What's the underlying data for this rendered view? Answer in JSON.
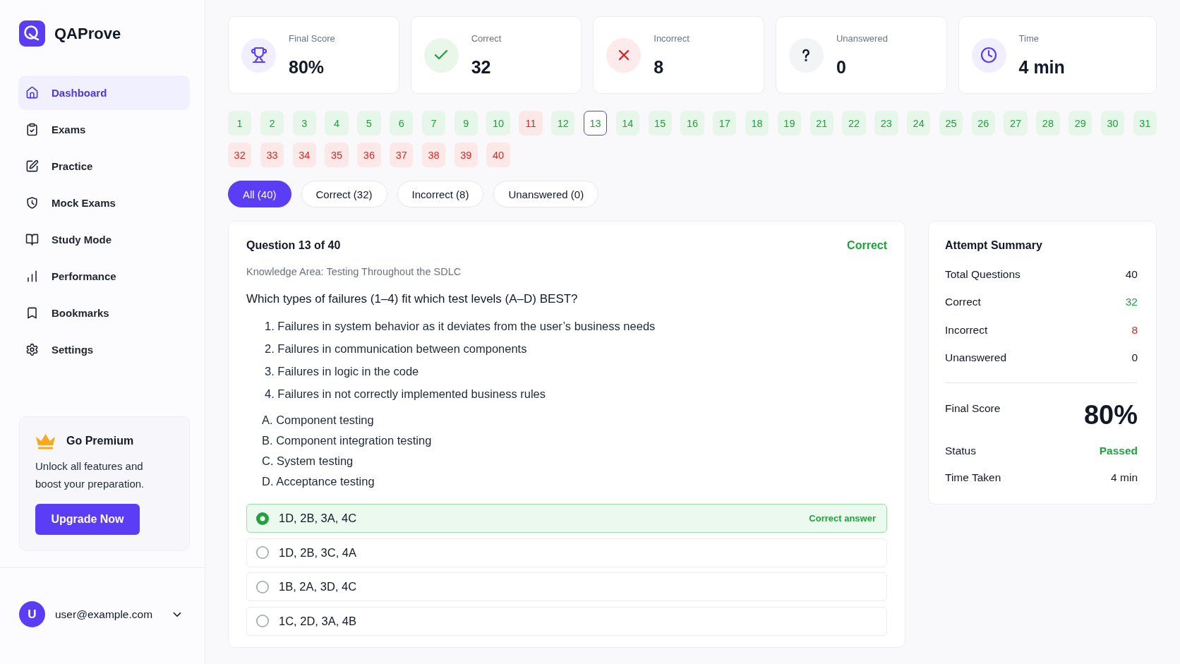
{
  "sidebar": {
    "brand": "QAProve",
    "nav": [
      {
        "label": "Dashboard",
        "selected": true
      },
      {
        "label": "Exams",
        "selected": false
      },
      {
        "label": "Practice",
        "selected": false
      },
      {
        "label": "Mock Exams",
        "selected": false
      },
      {
        "label": "Study Mode",
        "selected": false
      },
      {
        "label": "Performance",
        "selected": false
      },
      {
        "label": "Bookmarks",
        "selected": false
      },
      {
        "label": "Settings",
        "selected": false
      }
    ],
    "promo": {
      "title": "Go Premium",
      "text": "Unlock all features and boost your preparation.",
      "button": "Upgrade Now"
    },
    "user": {
      "initial": "U",
      "email": "user@example.com"
    }
  },
  "stats": [
    {
      "kind": "score",
      "label": "Final Score",
      "value": "80%"
    },
    {
      "kind": "correct",
      "label": "Correct",
      "value": "32"
    },
    {
      "kind": "incorrect",
      "label": "Incorrect",
      "value": "8"
    },
    {
      "kind": "unanswered",
      "label": "Unanswered",
      "value": "0"
    },
    {
      "kind": "time",
      "label": "Time",
      "value": "4 min"
    }
  ],
  "question_nav": [
    {
      "number": "1",
      "correct": true,
      "selected": false
    },
    {
      "number": "2",
      "correct": true,
      "selected": false
    },
    {
      "number": "3",
      "correct": true,
      "selected": false
    },
    {
      "number": "4",
      "correct": true,
      "selected": false
    },
    {
      "number": "5",
      "correct": true,
      "selected": false
    },
    {
      "number": "6",
      "correct": true,
      "selected": false
    },
    {
      "number": "7",
      "correct": true,
      "selected": false
    },
    {
      "number": "9",
      "correct": true,
      "selected": false
    },
    {
      "number": "10",
      "correct": true,
      "selected": false
    },
    {
      "number": "11",
      "correct": false,
      "selected": false
    },
    {
      "number": "12",
      "correct": true,
      "selected": false
    },
    {
      "number": "13",
      "correct": true,
      "selected": true
    },
    {
      "number": "14",
      "correct": true,
      "selected": false
    },
    {
      "number": "15",
      "correct": true,
      "selected": false
    },
    {
      "number": "16",
      "correct": true,
      "selected": false
    },
    {
      "number": "17",
      "correct": true,
      "selected": false
    },
    {
      "number": "18",
      "correct": true,
      "selected": false
    },
    {
      "number": "19",
      "correct": true,
      "selected": false
    },
    {
      "number": "21",
      "correct": true,
      "selected": false
    },
    {
      "number": "22",
      "correct": true,
      "selected": false
    },
    {
      "number": "23",
      "correct": true,
      "selected": false
    },
    {
      "number": "24",
      "correct": true,
      "selected": false
    },
    {
      "number": "25",
      "correct": true,
      "selected": false
    },
    {
      "number": "26",
      "correct": true,
      "selected": false
    },
    {
      "number": "27",
      "correct": true,
      "selected": false
    },
    {
      "number": "28",
      "correct": true,
      "selected": false
    },
    {
      "number": "29",
      "correct": true,
      "selected": false
    },
    {
      "number": "30",
      "correct": true,
      "selected": false
    },
    {
      "number": "31",
      "correct": true,
      "selected": false
    },
    {
      "number": "32",
      "correct": false,
      "selected": false
    },
    {
      "number": "33",
      "correct": false,
      "selected": false
    },
    {
      "number": "34",
      "correct": false,
      "selected": false
    },
    {
      "number": "35",
      "correct": false,
      "selected": false
    },
    {
      "number": "36",
      "correct": false,
      "selected": false
    },
    {
      "number": "37",
      "correct": false,
      "selected": false
    },
    {
      "number": "38",
      "correct": false,
      "selected": false
    },
    {
      "number": "39",
      "correct": false,
      "selected": false
    },
    {
      "number": "40",
      "correct": false,
      "selected": false
    }
  ],
  "filters": [
    {
      "label": "All (40)",
      "selected": true
    },
    {
      "label": "Correct (32)",
      "selected": false
    },
    {
      "label": "Incorrect (8)",
      "selected": false
    },
    {
      "label": "Unanswered (0)",
      "selected": false
    }
  ],
  "question": {
    "title": "Question 13 of 40",
    "result": {
      "label": "Correct",
      "correct": true
    },
    "area": "Knowledge Area: Testing Throughout the SDLC",
    "text": "Which types of failures (1–4) fit which test levels (A–D) BEST?",
    "statements": [
      "1. Failures in system behavior as it deviates from the user’s business needs",
      "2. Failures in communication between components",
      "3. Failures in logic in the code",
      "4. Failures in not correctly implemented business rules"
    ],
    "levels": [
      "A. Component testing",
      "B. Component integration testing",
      "C. System testing",
      "D. Acceptance testing"
    ],
    "options": [
      {
        "label": "1D, 2B, 3A, 4C",
        "selected": true,
        "correct": true,
        "note": "Correct answer"
      },
      {
        "label": "1D, 2B, 3C, 4A",
        "selected": false,
        "correct": false
      },
      {
        "label": "1B, 2A, 3D, 4C",
        "selected": false,
        "correct": false
      },
      {
        "label": "1C, 2D, 3A, 4B",
        "selected": false,
        "correct": false
      }
    ]
  },
  "summary": {
    "title": "Attempt Summary",
    "rows": [
      {
        "label": "Total Questions",
        "value": "40",
        "color": "#111827"
      },
      {
        "label": "Correct",
        "value": "32",
        "color": "#1ea33b"
      },
      {
        "label": "Incorrect",
        "value": "8",
        "color": "#dc2626"
      },
      {
        "label": "Unanswered",
        "value": "0",
        "color": "#111827"
      }
    ],
    "score": {
      "label": "Final Score",
      "value": "80%"
    },
    "details": [
      {
        "label": "Status",
        "value": "Passed",
        "color": "#1ea33b"
      },
      {
        "label": "Time Taken",
        "value": "4 min",
        "color": "#111827"
      }
    ]
  }
}
